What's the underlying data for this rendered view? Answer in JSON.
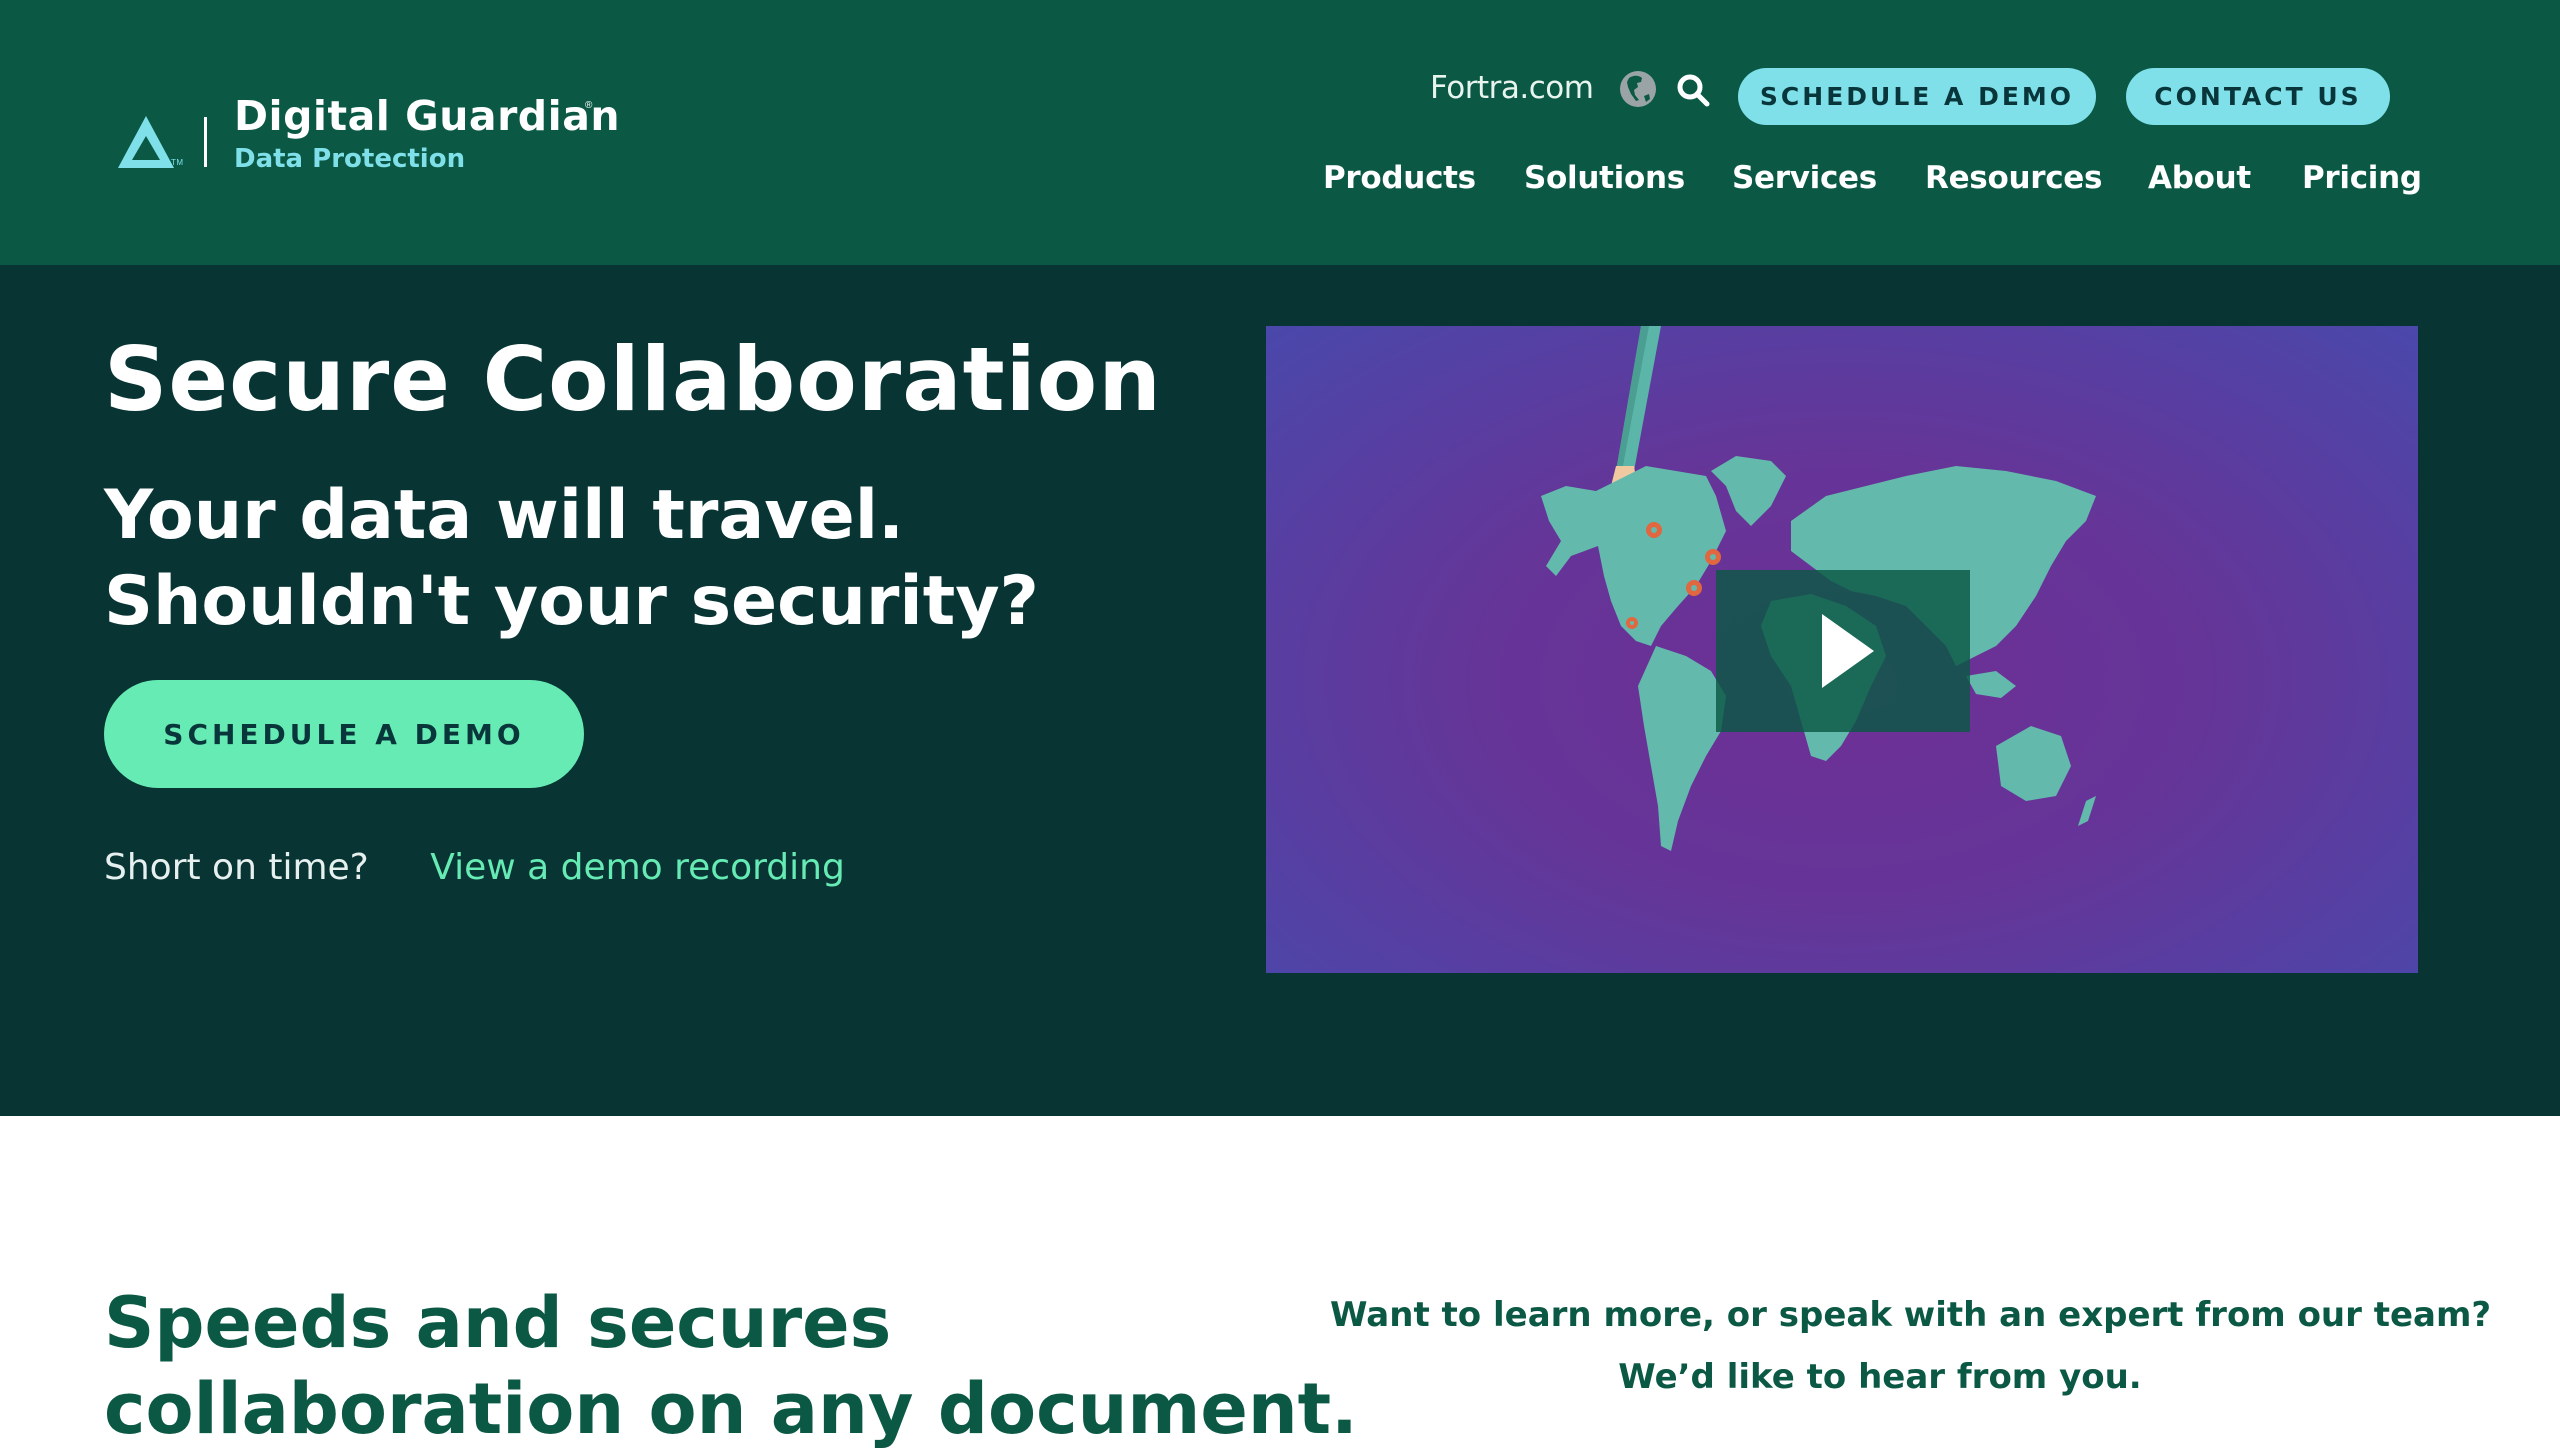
{
  "brand": {
    "name": "Digital Guardian",
    "registered_mark": "®",
    "trademark": "TM",
    "subtitle": "Data Protection",
    "colors": {
      "header_bg": "#0b5944",
      "hero_bg": "#083434",
      "accent_cyan": "#7fe0ea",
      "accent_green": "#66ebb4",
      "text_dark_green": "#0b5944"
    }
  },
  "utility_bar": {
    "fortra_link": "Fortra.com",
    "globe_icon": "globe-icon",
    "search_icon": "search-icon",
    "schedule_demo": "SCHEDULE A DEMO",
    "contact_us": "CONTACT US"
  },
  "nav": {
    "items": [
      {
        "label": "Products"
      },
      {
        "label": "Solutions"
      },
      {
        "label": "Services"
      },
      {
        "label": "Resources"
      },
      {
        "label": "About"
      },
      {
        "label": "Pricing"
      }
    ]
  },
  "hero": {
    "title": "Secure Collaboration",
    "subtitle_line1": "Your data will travel.",
    "subtitle_line2": "Shouldn't your security?",
    "cta": "SCHEDULE A DEMO",
    "short_on_time": "Short on time?",
    "demo_link": "View a demo recording",
    "video": {
      "play_icon": "play-icon",
      "illustration": "world map with hand holding document and location pins"
    }
  },
  "lower": {
    "title_line1": "Speeds and secures",
    "title_line2": "collaboration on any document.",
    "contact_line1": "Want to learn more, or speak with an expert from our team?",
    "contact_line2": "We’d like to hear from you."
  }
}
